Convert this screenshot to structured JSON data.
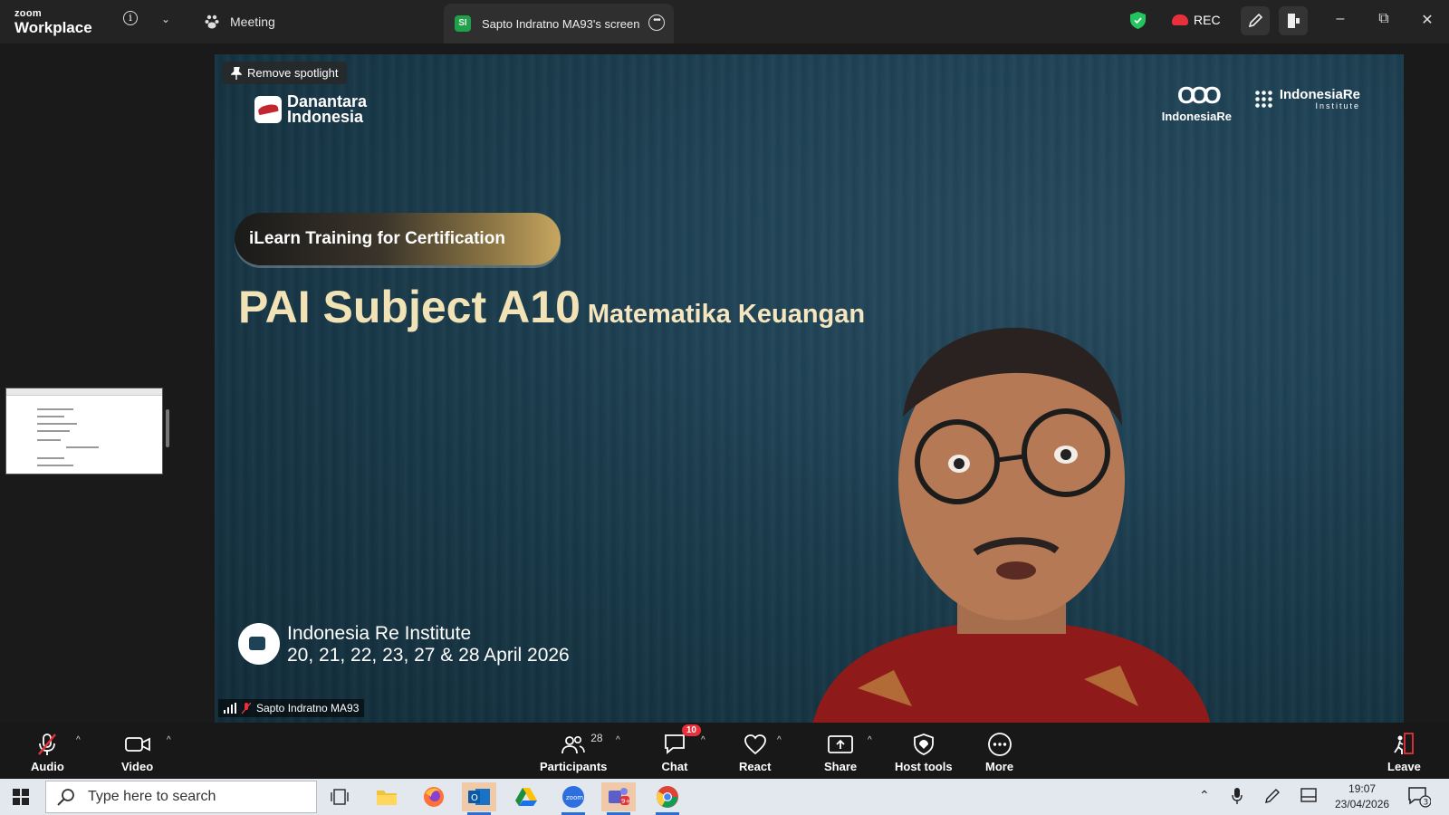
{
  "app": {
    "logo_top": "zoom",
    "logo_bottom": "Workplace"
  },
  "tabs": {
    "meeting": "Meeting",
    "screen": "Sapto Indratno MA93's screen",
    "screen_badge": "SI"
  },
  "status": {
    "rec": "REC"
  },
  "video": {
    "remove_spotlight": "Remove spotlight",
    "danantara_line1": "Danantara",
    "danantara_line2": "Indonesia",
    "ire_logo_label": "IndonesiaRe",
    "ire_inst_line1": "IndonesiaRe",
    "ire_inst_line2": "Institute",
    "ilearn": "iLearn Training for Certification",
    "pai_title": "PAI Subject A10",
    "pai_subtitle": "Matematika Keuangan",
    "event_title": "Indonesia Re Institute",
    "event_dates": "20, 21, 22, 23, 27 & 28 April 2026",
    "participant_name": "Sapto Indratno MA93"
  },
  "toolbar": {
    "audio": "Audio",
    "video": "Video",
    "participants": "Participants",
    "participants_count": "28",
    "chat": "Chat",
    "chat_badge": "10",
    "react": "React",
    "share": "Share",
    "host_tools": "Host tools",
    "more": "More",
    "leave": "Leave"
  },
  "taskbar": {
    "search_placeholder": "Type here to search",
    "time": "19:07",
    "date": "23/04/2026",
    "notifications": "3"
  },
  "colors": {
    "accent_red": "#e8303c",
    "badge_green": "#1fa14a",
    "title_gold": "#f1e3b6"
  }
}
